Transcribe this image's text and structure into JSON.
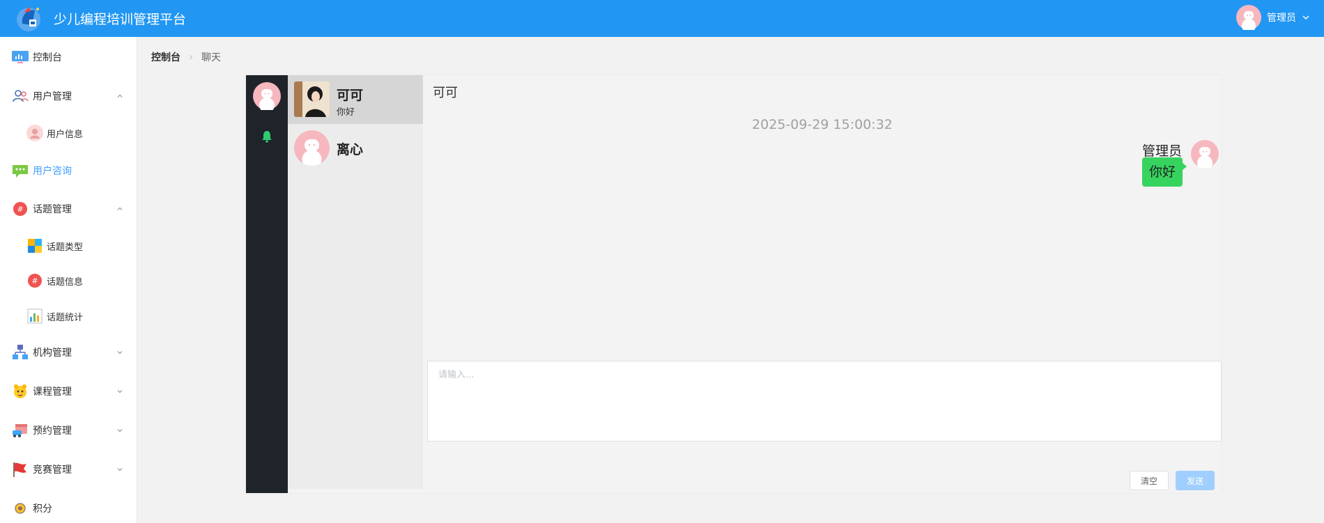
{
  "app": {
    "title": "少儿编程培训管理平台"
  },
  "header": {
    "user_name": "管理员"
  },
  "sidebar": {
    "items": [
      {
        "label": "控制台",
        "icon": "monitor-chart-icon"
      },
      {
        "label": "用户管理",
        "icon": "users-icon",
        "expanded": true
      },
      {
        "label": "用户信息",
        "icon": "user-avatar-icon"
      },
      {
        "label": "用户咨询",
        "icon": "chat-bubble-icon",
        "active": true
      },
      {
        "label": "话题管理",
        "icon": "hashtag-icon",
        "expanded": true
      },
      {
        "label": "话题类型",
        "icon": "colored-blocks-icon"
      },
      {
        "label": "话题信息",
        "icon": "hashtag-icon"
      },
      {
        "label": "话题统计",
        "icon": "bar-chart-icon"
      },
      {
        "label": "机构管理",
        "icon": "org-tree-icon",
        "expanded": false
      },
      {
        "label": "课程管理",
        "icon": "mascot-icon",
        "expanded": false
      },
      {
        "label": "预约管理",
        "icon": "calendar-car-icon",
        "expanded": false
      },
      {
        "label": "竞赛管理",
        "icon": "flag-icon",
        "expanded": false
      },
      {
        "label": "积分",
        "icon": "coin-icon"
      }
    ]
  },
  "breadcrumb": {
    "home": "控制台",
    "current": "聊天"
  },
  "chat": {
    "contacts": [
      {
        "name": "可可",
        "preview": "你好",
        "selected": true
      },
      {
        "name": "离心",
        "preview": ""
      }
    ],
    "conversation": {
      "title": "可可",
      "timestamp": "2025-09-29 15:00:32",
      "messages": [
        {
          "sender": "管理员",
          "text": "你好"
        }
      ]
    },
    "input": {
      "placeholder": "请输入...",
      "value": ""
    },
    "buttons": {
      "clear": "清空",
      "send": "发送"
    }
  },
  "colors": {
    "header": "#2196f3",
    "active_menu": "#409eff",
    "rail": "#1f242a",
    "bubble": "#37d35f",
    "send_disabled": "#a0cfff"
  }
}
